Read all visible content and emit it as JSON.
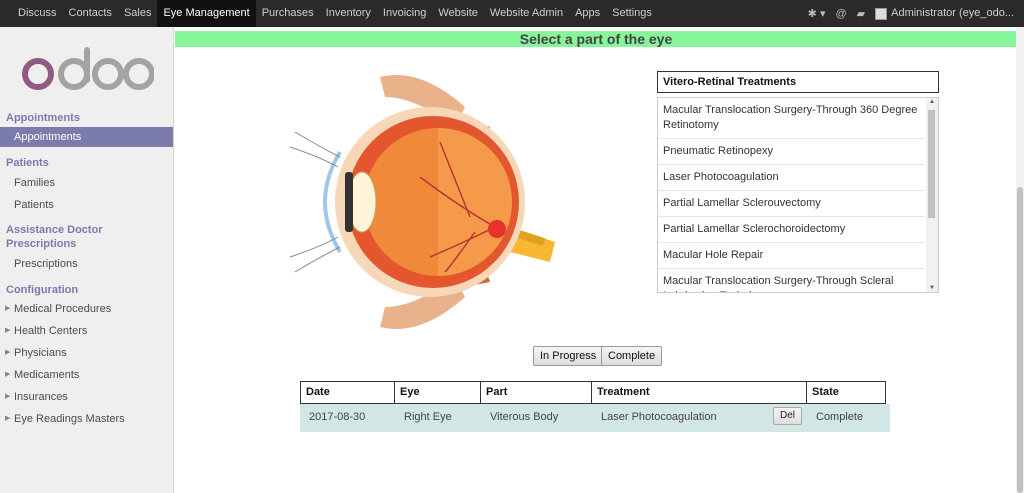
{
  "topbar": {
    "menu": [
      "Discuss",
      "Contacts",
      "Sales",
      "Eye Management",
      "Purchases",
      "Inventory",
      "Invoicing",
      "Website",
      "Website Admin",
      "Apps",
      "Settings"
    ],
    "active": "Eye Management",
    "user": "Administrator (eye_odo..."
  },
  "sidebar": {
    "logo_text": "odoo",
    "sections": [
      {
        "title": "Appointments",
        "items": [
          "Appointments"
        ]
      },
      {
        "title": "Patients",
        "items": [
          "Families",
          "Patients"
        ]
      },
      {
        "title": "Assistance Doctor Prescriptions",
        "items": [
          "Prescriptions"
        ]
      },
      {
        "title": "Configuration",
        "items": [
          "Medical Procedures",
          "Health Centers",
          "Physicians",
          "Medicaments",
          "Insurances",
          "Eye Readings Masters"
        ]
      }
    ]
  },
  "main": {
    "title": "Select a part of the eye",
    "treatments_header": "Vitero-Retinal Treatments",
    "treatments": [
      "Macular Translocation Surgery-Through 360 Degree Retinotomy",
      "Pneumatic Retinopexy",
      "Laser Photocoagulation",
      "Partial Lamellar Sclerouvectomy",
      "Partial Lamellar Sclerochoroidectomy",
      "Macular Hole Repair",
      "Macular Translocation Surgery-Through Scleral Imbrication Technique"
    ],
    "btn_in_progress": "In Progress",
    "btn_complete": "Complete",
    "table": {
      "headers": [
        "Date",
        "Eye",
        "Part",
        "Treatment",
        "State"
      ],
      "rows": [
        {
          "date": "2017-08-30",
          "eye": "Right Eye",
          "part": "Viterous Body",
          "treatment": "Laser Photocoagulation",
          "state": "Complete",
          "del": "Del"
        }
      ]
    }
  }
}
